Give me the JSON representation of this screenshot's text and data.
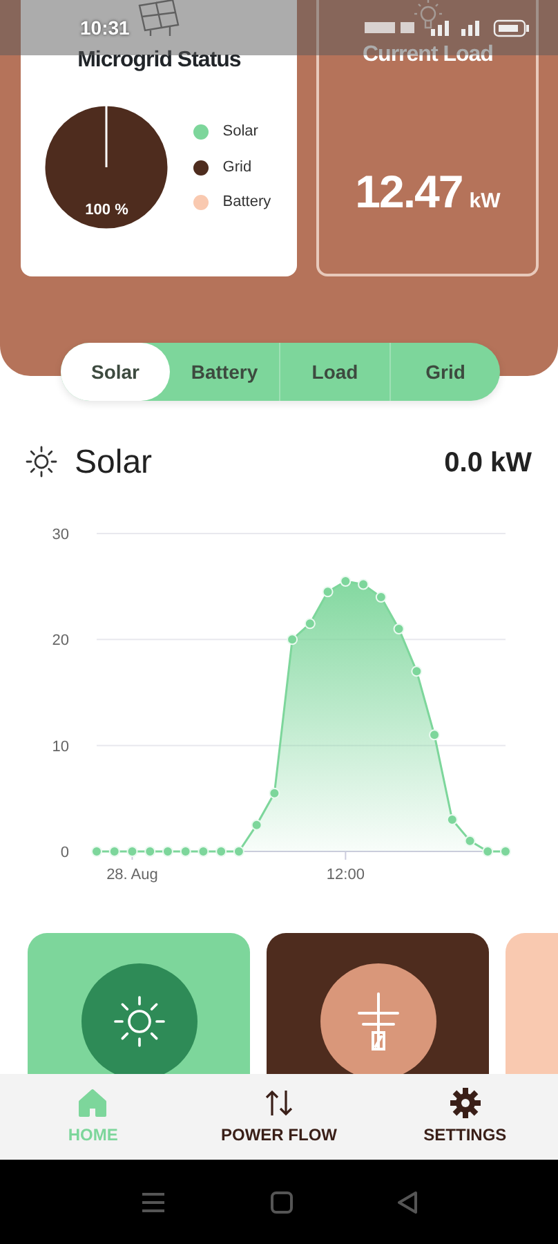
{
  "status_bar": {
    "time": "10:31"
  },
  "microgrid_status": {
    "title": "Microgrid Status",
    "center_label": "100 %",
    "chart_data": {
      "type": "pie",
      "categories": [
        "Solar",
        "Grid",
        "Battery"
      ],
      "values": [
        0,
        100,
        0
      ],
      "colors": [
        "#7dd69b",
        "#4e2c1e",
        "#f9c9b0"
      ]
    }
  },
  "current_load": {
    "title": "Current Load",
    "value": "12.47",
    "unit": "kW"
  },
  "tabs": [
    {
      "label": "Solar",
      "selected": true
    },
    {
      "label": "Battery",
      "selected": false
    },
    {
      "label": "Load",
      "selected": false
    },
    {
      "label": "Grid",
      "selected": false
    }
  ],
  "section": {
    "title": "Solar",
    "reading": "0.0 kW"
  },
  "chart": {
    "chart_data": {
      "type": "area",
      "categories": [
        null,
        null,
        "28. Aug",
        null,
        null,
        null,
        null,
        null,
        null,
        null,
        null,
        null,
        null,
        null,
        "12:00",
        null,
        null,
        null,
        null,
        null,
        null,
        null,
        null,
        null
      ],
      "series": [
        {
          "color": "#7dd69b",
          "values": [
            0,
            0,
            0,
            0,
            0,
            0,
            0,
            0,
            0,
            2.5,
            5.5,
            20,
            21.5,
            24.5,
            25.5,
            25.2,
            24,
            21,
            17,
            11,
            3,
            1,
            0,
            0
          ]
        }
      ],
      "ylim": [
        0,
        30
      ],
      "yticks": [
        0,
        10,
        20,
        30
      ]
    }
  },
  "source_cards": [
    {
      "kind": "solar",
      "color": "#7dd69b"
    },
    {
      "kind": "grid",
      "color": "#4e2c1e"
    },
    {
      "kind": "battery",
      "color": "#f9c9b0"
    }
  ],
  "bottom_nav": [
    {
      "label": "HOME",
      "kind": "home",
      "selected": true
    },
    {
      "label": "POWER FLOW",
      "kind": "flow",
      "selected": false
    },
    {
      "label": "SETTINGS",
      "kind": "settings",
      "selected": false
    }
  ]
}
